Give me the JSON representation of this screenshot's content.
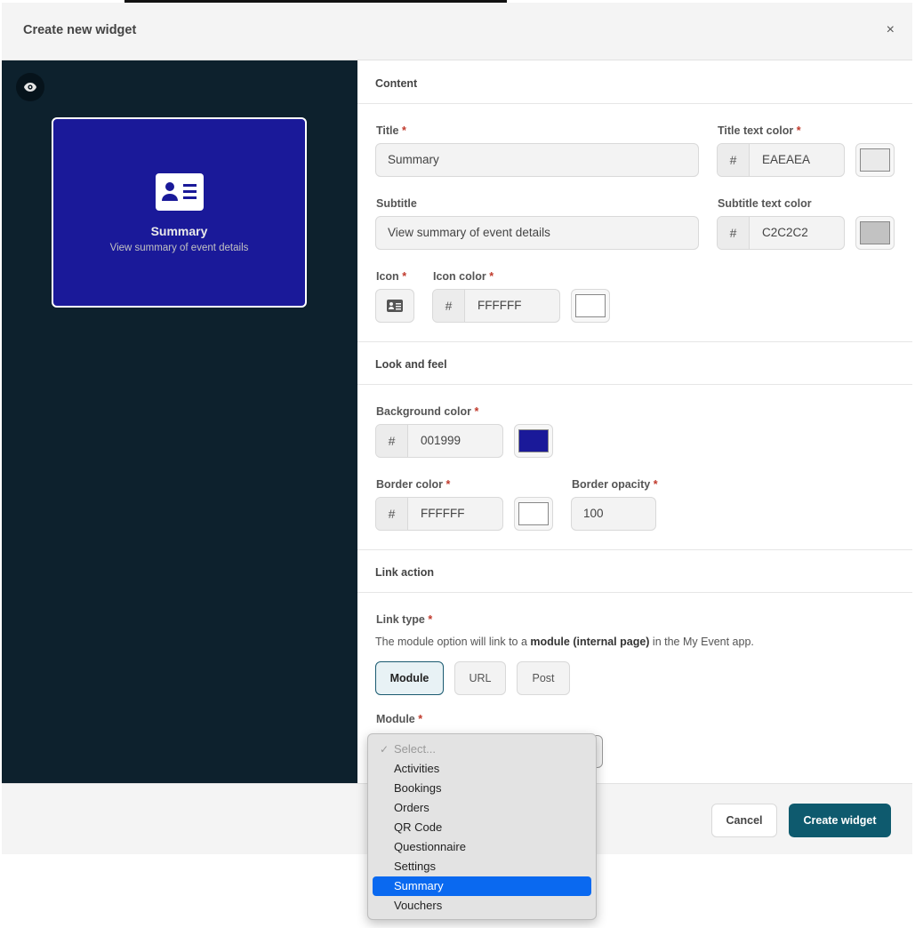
{
  "modal": {
    "title": "Create new widget",
    "close": "×"
  },
  "preview": {
    "widget_title": "Summary",
    "widget_subtitle": "View summary of event details",
    "background_color": "#1a1999"
  },
  "sections": {
    "content": "Content",
    "look_and_feel": "Look and feel",
    "link_action": "Link action"
  },
  "fields": {
    "title": {
      "label": "Title",
      "value": "Summary"
    },
    "title_color": {
      "label": "Title text color",
      "value": "EAEAEA",
      "swatch": "#EAEAEA"
    },
    "subtitle": {
      "label": "Subtitle",
      "value": "View summary of event details"
    },
    "subtitle_color": {
      "label": "Subtitle text color",
      "value": "C2C2C2",
      "swatch": "#C2C2C2"
    },
    "icon": {
      "label": "Icon"
    },
    "icon_color": {
      "label": "Icon color",
      "value": "FFFFFF",
      "swatch": "#FFFFFF"
    },
    "background_color": {
      "label": "Background color",
      "value": "001999",
      "swatch": "#1a1999"
    },
    "border_color": {
      "label": "Border color",
      "value": "FFFFFF",
      "swatch": "#FFFFFF"
    },
    "border_opacity": {
      "label": "Border opacity",
      "value": "100"
    },
    "link_type": {
      "label": "Link type",
      "hint_pre": "The module option will link to a ",
      "hint_bold": "module (internal page)",
      "hint_post": " in the My Event app.",
      "options": [
        "Module",
        "URL",
        "Post"
      ],
      "selected": "Module"
    },
    "module": {
      "label": "Module"
    }
  },
  "hash": "#",
  "required": "*",
  "dropdown": {
    "placeholder": "Select...",
    "options": [
      "Activities",
      "Bookings",
      "Orders",
      "QR Code",
      "Questionnaire",
      "Settings",
      "Summary",
      "Vouchers"
    ],
    "selected": "Summary"
  },
  "footer": {
    "cancel": "Cancel",
    "create": "Create widget"
  }
}
